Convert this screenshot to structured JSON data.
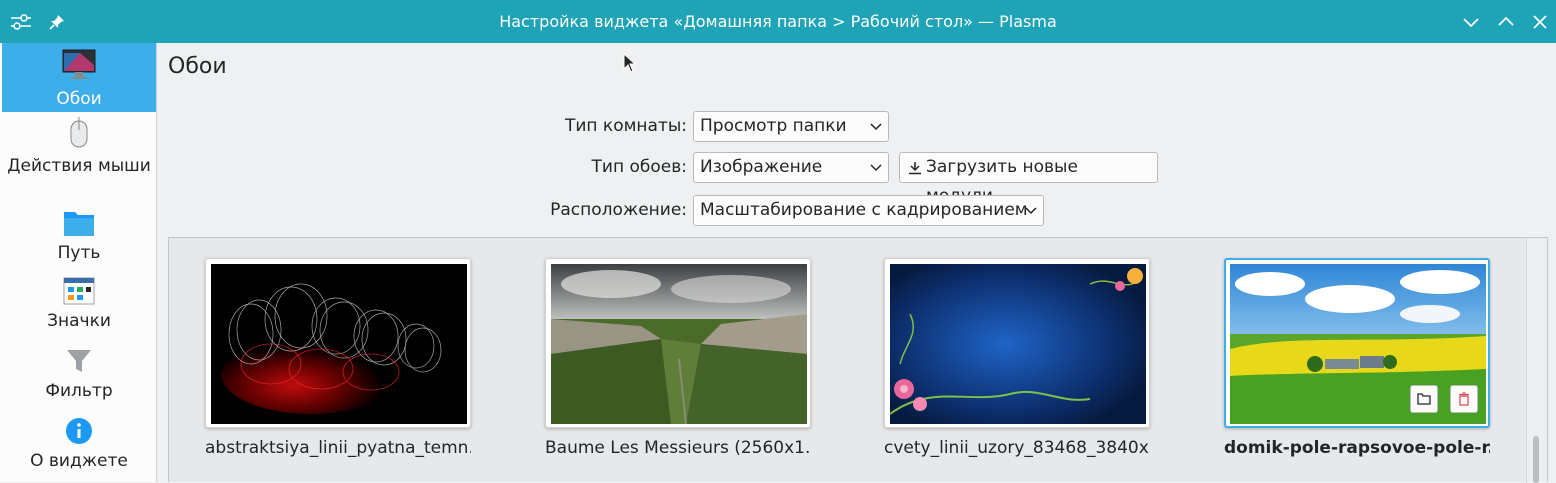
{
  "window": {
    "title": "Настройка виджета «Домашняя папка > Рабочий стол» — Plasma"
  },
  "sidebar": {
    "items": [
      {
        "label": "Обои",
        "icon": "monitor-icon"
      },
      {
        "label": "Действия мыши",
        "icon": "mouse-icon"
      },
      {
        "label": "Путь",
        "icon": "folder-icon"
      },
      {
        "label": "Значки",
        "icon": "icons-view-icon"
      },
      {
        "label": "Фильтр",
        "icon": "filter-icon"
      },
      {
        "label": "О виджете",
        "icon": "info-icon"
      }
    ],
    "active_index": 0
  },
  "main": {
    "title": "Обои",
    "form": {
      "room_type_label": "Тип комнаты:",
      "room_type_value": "Просмотр папки",
      "wallpaper_type_label": "Тип обоев:",
      "wallpaper_type_value": "Изображение",
      "get_new_label": "Загрузить новые модули...",
      "positioning_label": "Расположение:",
      "positioning_value": "Масштабирование с кадрированием"
    },
    "wallpapers": [
      {
        "name": "abstraktsiya_linii_pyatna_temn...",
        "selected": false
      },
      {
        "name": "Baume Les Messieurs (2560x1...",
        "selected": false
      },
      {
        "name": "cvety_linii_uzory_83468_3840x...",
        "selected": false
      },
      {
        "name": "domik-pole-rapsovoe-pole-r...",
        "selected": true
      }
    ]
  },
  "colors": {
    "titlebar": "#1fa3b6",
    "accent": "#3daee9",
    "background": "#eff0f1"
  }
}
